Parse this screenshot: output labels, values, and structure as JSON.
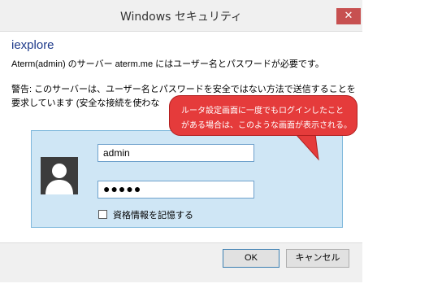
{
  "window": {
    "title": "Windows セキュリティ",
    "close_glyph": "✕"
  },
  "header": {
    "app_name": "iexplore",
    "line1": "Aterm(admin) のサーバー aterm.me にはユーザー名とパスワードが必要です。",
    "warning_line1": "警告: このサーバーは、ユーザー名とパスワードを安全ではない方法で送信することを",
    "warning_line2": "要求しています (安全な接続を使わな"
  },
  "credentials": {
    "username_value": "admin",
    "password_value": "●●●●●",
    "remember_label": "資格情報を記憶する",
    "remember_checked": false
  },
  "buttons": {
    "ok_label": "OK",
    "cancel_label": "キャンセル"
  },
  "annotation": {
    "line1": "ルータ設定画面に一度でもログインしたこと",
    "line2": "がある場合は、このような画面が表示される。"
  },
  "colors": {
    "callout": "#e53b3b",
    "panel": "#cfe6f5",
    "close": "#c75050"
  },
  "icons": {
    "avatar": "user-silhouette-icon",
    "close": "close-icon"
  }
}
